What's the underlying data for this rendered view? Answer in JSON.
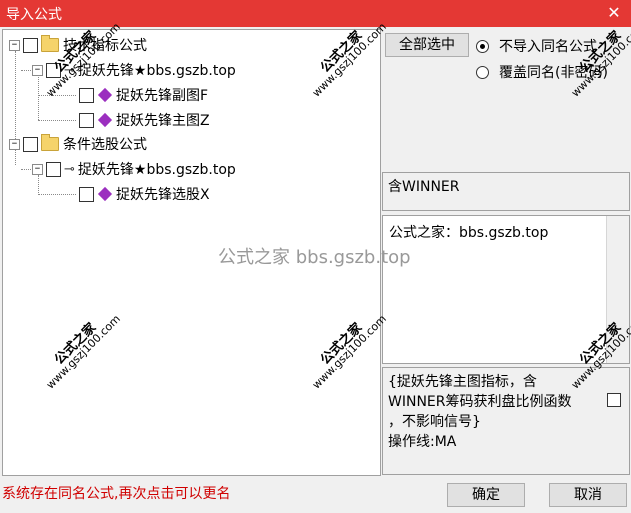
{
  "window": {
    "title": "导入公式",
    "close_glyph": "✕"
  },
  "tree": {
    "nodes": [
      {
        "id": "tech",
        "label": "技术指标公式",
        "expander": "−"
      },
      {
        "id": "tech-child",
        "label": "捉妖先锋★bbs.gszb.top",
        "expander": "−"
      },
      {
        "id": "tech-leaf1",
        "label": "捉妖先锋副图F"
      },
      {
        "id": "tech-leaf2",
        "label": "捉妖先锋主图Z"
      },
      {
        "id": "cond",
        "label": "条件选股公式",
        "expander": "−"
      },
      {
        "id": "cond-child",
        "label": "捉妖先锋★bbs.gszb.top",
        "expander": "−"
      },
      {
        "id": "cond-leaf1",
        "label": "捉妖先锋选股X"
      }
    ]
  },
  "controls": {
    "select_all": "全部选中",
    "radio_skip": "不导入同名公式",
    "radio_overwrite": "覆盖同名(非密码)",
    "radio_skip_selected": true
  },
  "info": {
    "contains": "含WINNER",
    "description": "公式之家：bbs.gszb.top",
    "note_lines": [
      "{捉妖先锋主图指标，含",
      "WINNER筹码获利盘比例函数",
      "，不影响信号}",
      "操作线:MA"
    ]
  },
  "status_text": "系统存在同名公式,再次点击可以更名",
  "buttons": {
    "ok": "确定",
    "cancel": "取消"
  },
  "watermark": {
    "brand": "公式之家",
    "url": "www.gszj100.com",
    "center_text": "公式之家 bbs.gszb.top"
  }
}
